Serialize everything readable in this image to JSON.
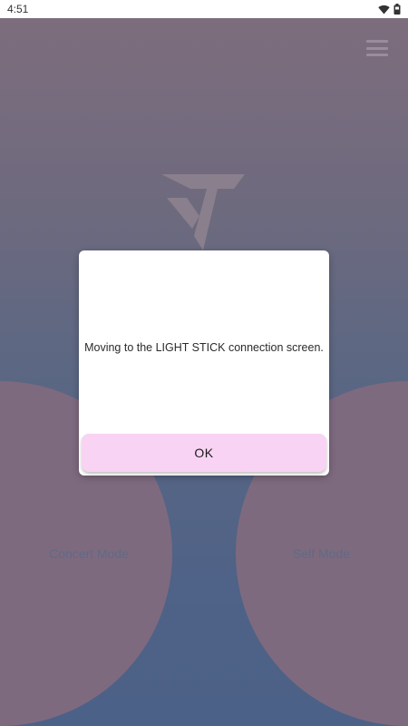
{
  "status_bar": {
    "time": "4:51",
    "icons": [
      "wifi-icon",
      "battery-icon"
    ]
  },
  "app": {
    "menu_icon": "hamburger-menu-icon",
    "logo_icon": "v-logo-icon",
    "modes": {
      "concert_label": "Concert Mode",
      "self_label": "Self Mode"
    }
  },
  "dialog": {
    "message": "Moving to the LIGHT STICK connection screen.",
    "ok_label": "OK"
  },
  "colors": {
    "background_top": "#7d6d7d",
    "background_bottom": "#4c6187",
    "mode_circle": "#7e6a7f",
    "ok_button": "#f8d3f3"
  }
}
